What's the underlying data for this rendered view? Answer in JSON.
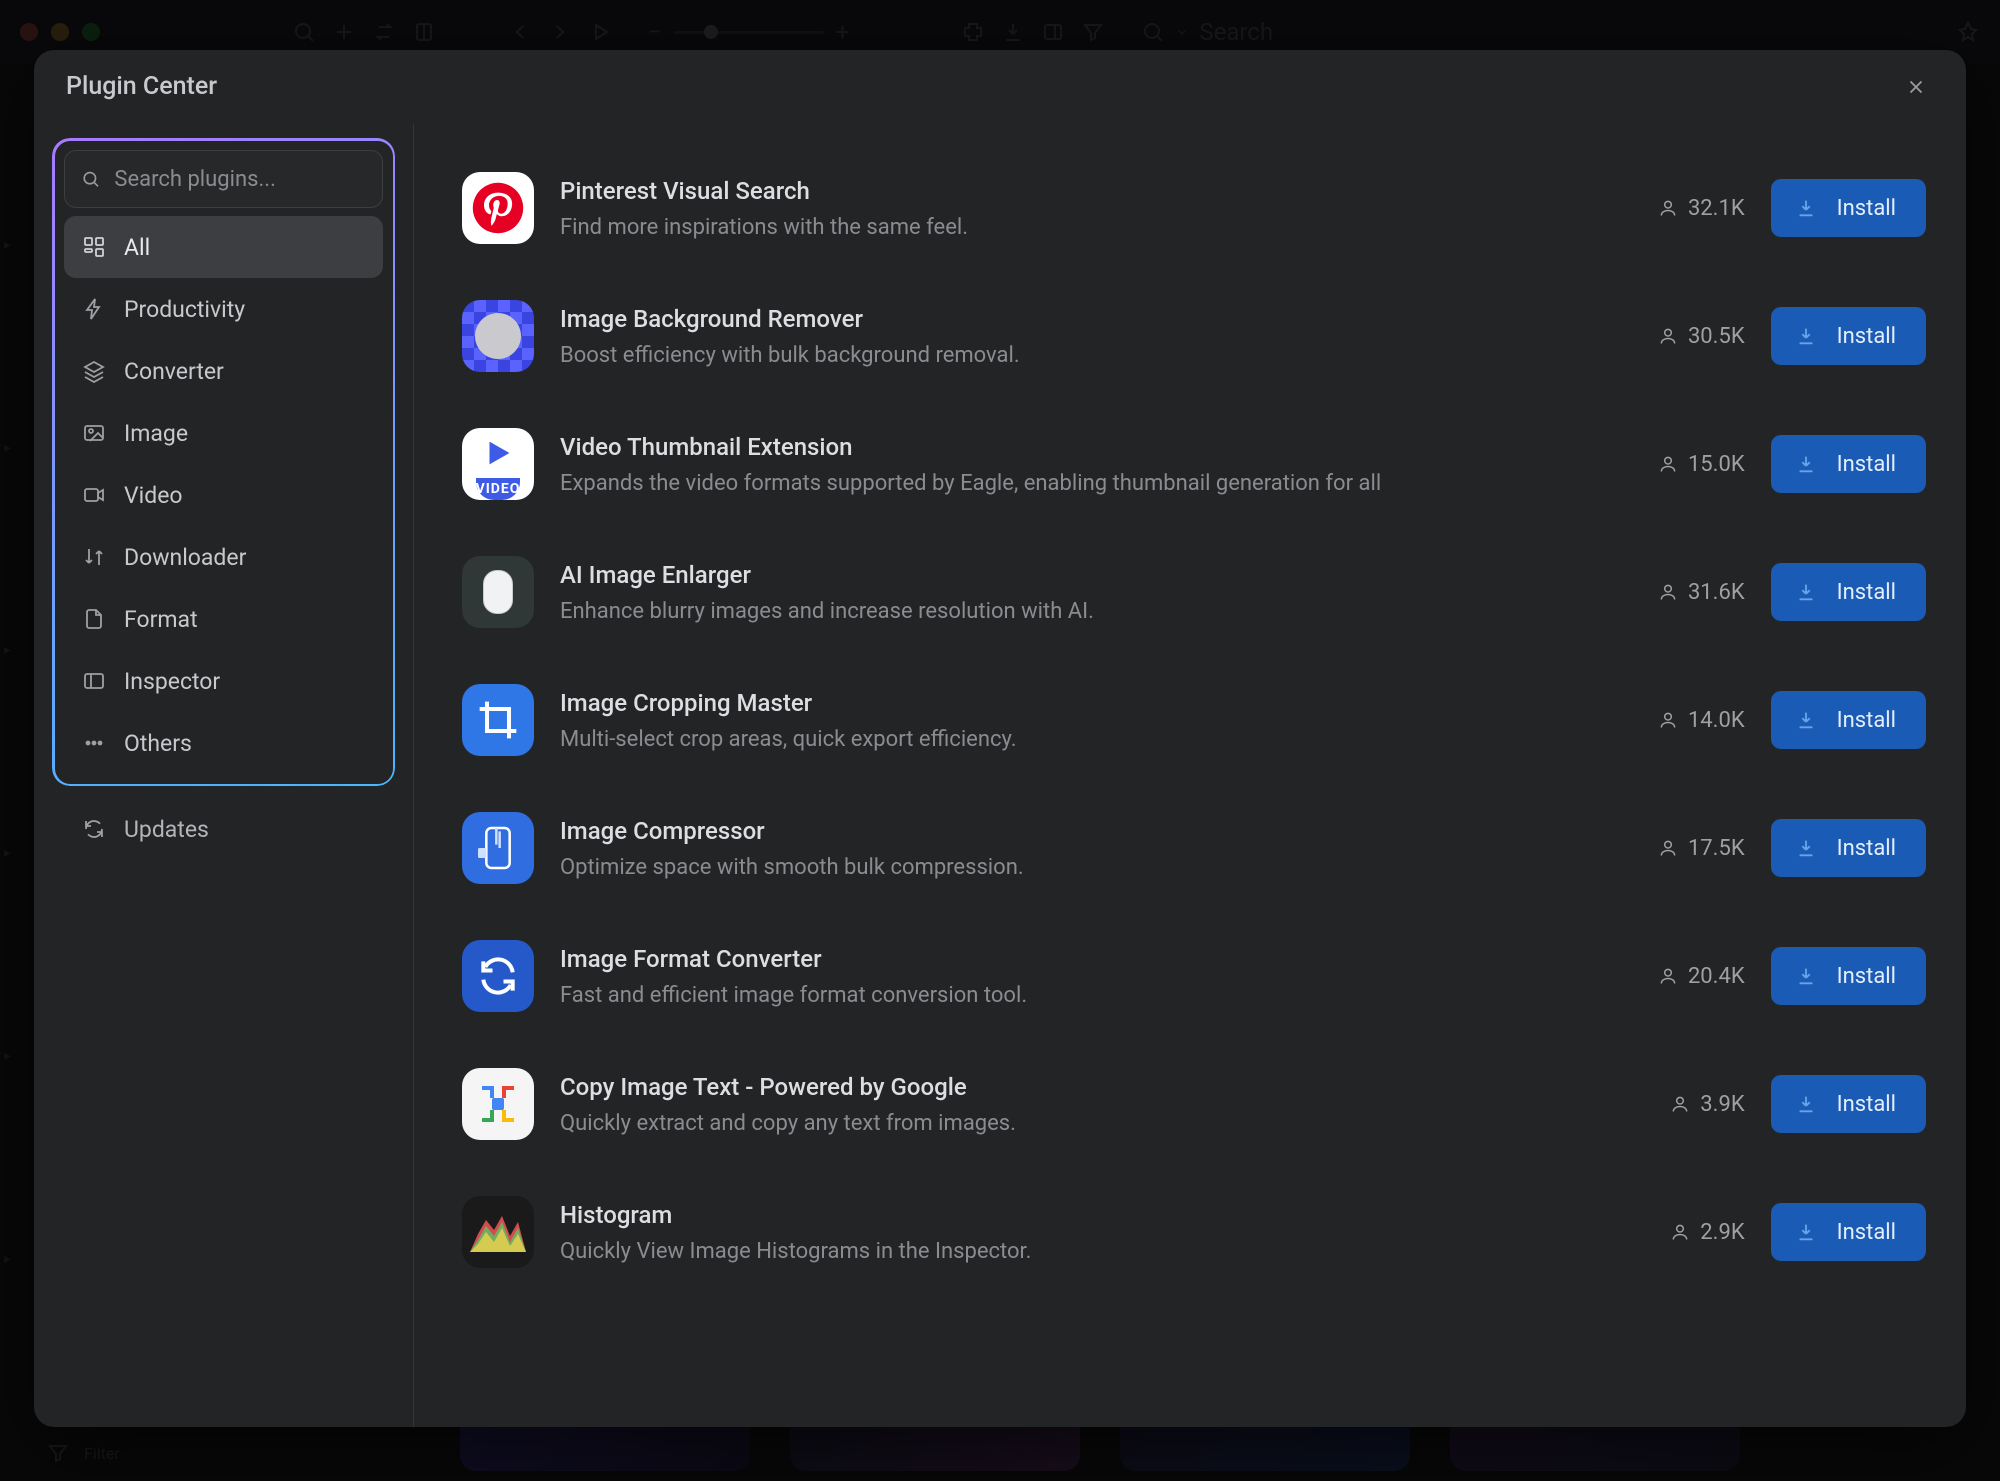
{
  "toolbar": {
    "search_placeholder": "Search"
  },
  "bottom": {
    "filter_label": "Filter"
  },
  "modal": {
    "title": "Plugin Center",
    "search_placeholder": "Search plugins...",
    "updates_label": "Updates",
    "install_label": "Install",
    "categories": [
      {
        "key": "all",
        "label": "All",
        "icon": "grid"
      },
      {
        "key": "productivity",
        "label": "Productivity",
        "icon": "bolt"
      },
      {
        "key": "converter",
        "label": "Converter",
        "icon": "layers"
      },
      {
        "key": "image",
        "label": "Image",
        "icon": "image"
      },
      {
        "key": "video",
        "label": "Video",
        "icon": "video"
      },
      {
        "key": "downloader",
        "label": "Downloader",
        "icon": "updown"
      },
      {
        "key": "format",
        "label": "Format",
        "icon": "file"
      },
      {
        "key": "inspector",
        "label": "Inspector",
        "icon": "panel"
      },
      {
        "key": "others",
        "label": "Others",
        "icon": "dots"
      }
    ],
    "plugins": [
      {
        "name": "Pinterest Visual Search",
        "desc": "Find more inspirations with the same feel.",
        "users": "32.1K",
        "icon": "pinterest"
      },
      {
        "name": "Image Background Remover",
        "desc": "Boost efficiency with bulk background removal.",
        "users": "30.5K",
        "icon": "bgremove"
      },
      {
        "name": "Video Thumbnail Extension",
        "desc": "Expands the video formats supported by Eagle, enabling thumbnail generation for all",
        "users": "15.0K",
        "icon": "video"
      },
      {
        "name": "AI Image Enlarger",
        "desc": "Enhance blurry images and increase resolution with AI.",
        "users": "31.6K",
        "icon": "enlarge"
      },
      {
        "name": "Image Cropping Master",
        "desc": "Multi-select crop areas, quick export efficiency.",
        "users": "14.0K",
        "icon": "crop"
      },
      {
        "name": "Image Compressor",
        "desc": "Optimize space with smooth bulk compression.",
        "users": "17.5K",
        "icon": "compress"
      },
      {
        "name": "Image Format Converter",
        "desc": "Fast and efficient image format conversion tool.",
        "users": "20.4K",
        "icon": "convert"
      },
      {
        "name": "Copy Image Text - Powered by Google",
        "desc": "Quickly extract and copy any text from images.",
        "users": "3.9K",
        "icon": "ocr"
      },
      {
        "name": "Histogram",
        "desc": "Quickly View Image Histograms in the Inspector.",
        "users": "2.9K",
        "icon": "histogram"
      }
    ]
  }
}
